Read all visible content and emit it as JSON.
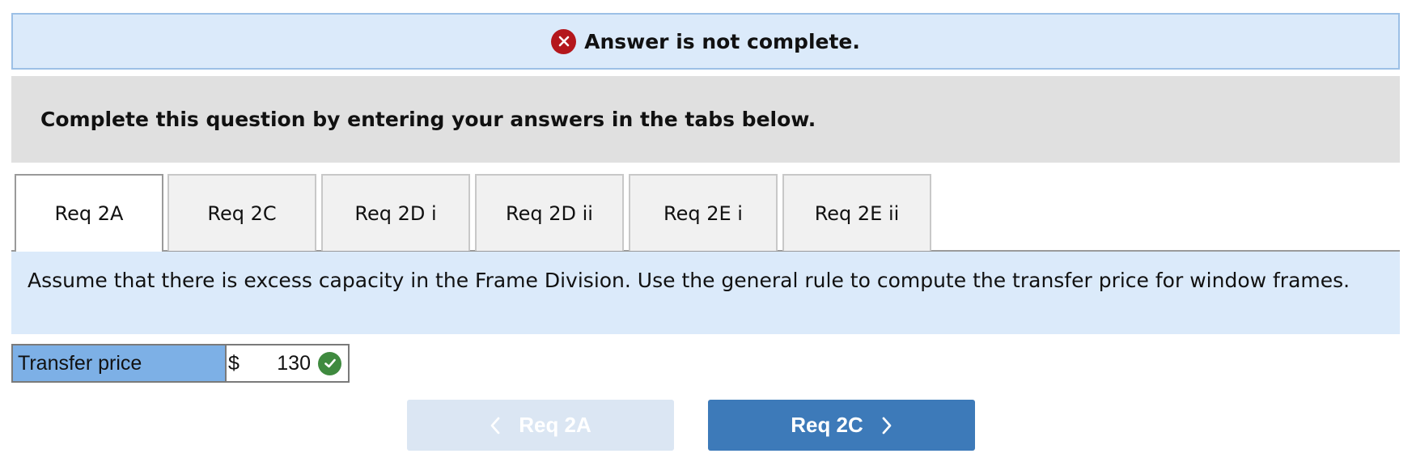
{
  "banner": {
    "icon": "error-x-icon",
    "title": "Answer is not complete."
  },
  "instructions": {
    "text": "Complete this question by entering your answers in the tabs below."
  },
  "tabs": [
    {
      "label": "Req 2A",
      "active": true
    },
    {
      "label": "Req 2C",
      "active": false
    },
    {
      "label": "Req 2D i",
      "active": false
    },
    {
      "label": "Req 2D ii",
      "active": false
    },
    {
      "label": "Req 2E i",
      "active": false
    },
    {
      "label": "Req 2E ii",
      "active": false
    }
  ],
  "question": {
    "text": "Assume that there is excess capacity in the Frame Division. Use the general rule to compute the transfer price for window frames."
  },
  "answer": {
    "label": "Transfer price",
    "currency": "$",
    "value": "130",
    "status_icon": "check-circle-icon"
  },
  "nav": {
    "prev_label": "Req 2A",
    "next_label": "Req 2C"
  },
  "colors": {
    "banner_bg": "#dbeafa",
    "error_red": "#b4171c",
    "correct_green": "#3f8a3f",
    "label_blue": "#7db0e6",
    "next_button": "#3d7ab9",
    "prev_button_disabled": "#dbe6f3"
  }
}
